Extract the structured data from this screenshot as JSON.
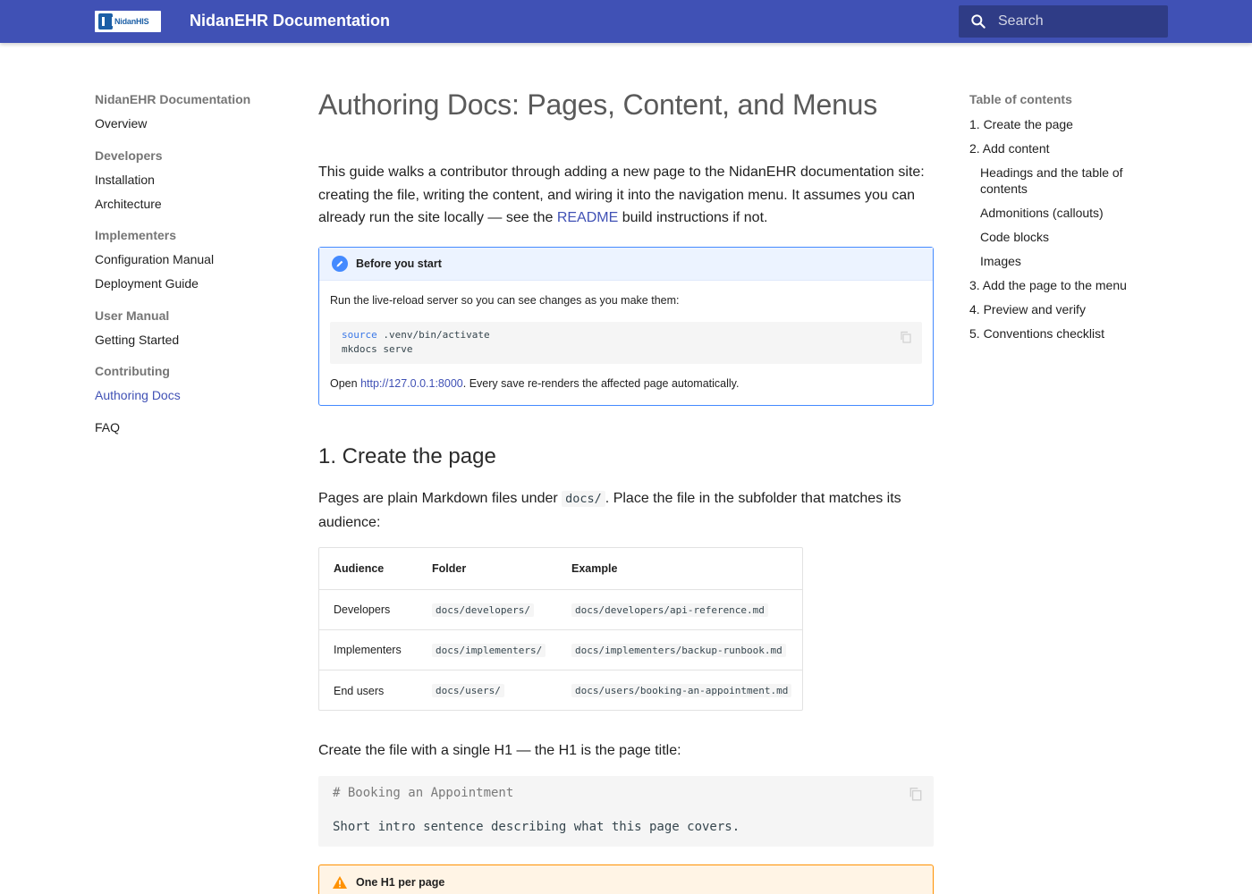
{
  "header": {
    "logo_text": "NidanHIS",
    "site_title": "NidanEHR Documentation",
    "search_placeholder": "Search"
  },
  "nav": {
    "root_title": "NidanEHR Documentation",
    "overview": "Overview",
    "sections": [
      {
        "title": "Developers",
        "items": [
          "Installation",
          "Architecture"
        ]
      },
      {
        "title": "Implementers",
        "items": [
          "Configuration Manual",
          "Deployment Guide"
        ]
      },
      {
        "title": "User Manual",
        "items": [
          "Getting Started"
        ]
      },
      {
        "title": "Contributing",
        "items": [
          "Authoring Docs"
        ]
      }
    ],
    "faq": "FAQ",
    "active_item": "Authoring Docs"
  },
  "toc": {
    "title": "Table of contents",
    "items": [
      "1. Create the page",
      "2. Add content",
      "Headings and the table of contents",
      "Admonitions (callouts)",
      "Code blocks",
      "Images",
      "3. Add the page to the menu",
      "4. Preview and verify",
      "5. Conventions checklist"
    ]
  },
  "page": {
    "title": "Authoring Docs: Pages, Content, and Menus",
    "intro_line1": "This guide walks a contributor through adding a new page to the NidanEHR documentation site:",
    "intro_line2": "creating the file, writing the content, and wiring it into the navigation menu. It assumes you can",
    "intro_line3_before": "already run the site locally — see the ",
    "intro_link": "README",
    "intro_line3_after": " build instructions if not.",
    "note": {
      "title": "Before you start",
      "text": "Run the live-reload server so you can see changes as you make them:",
      "code_kw": "source",
      "code_line1_rest": " .venv/bin/activate",
      "code_line2": "mkdocs serve",
      "open_before": "Open ",
      "open_link": "http://127.0.0.1:8000",
      "open_after": ". Every save re-renders the affected page automatically."
    },
    "section1": {
      "heading": "1. Create the page",
      "p_before": "Pages are plain Markdown files under ",
      "p_code": "docs/",
      "p_after_line1": ". Place the file in the subfolder that matches its",
      "p_line2": "audience:",
      "table": {
        "headers": [
          "Audience",
          "Folder",
          "Example"
        ],
        "rows": [
          [
            "Developers",
            "docs/developers/",
            "docs/developers/api-reference.md"
          ],
          [
            "Implementers",
            "docs/implementers/",
            "docs/implementers/backup-runbook.md"
          ],
          [
            "End users",
            "docs/users/",
            "docs/users/booking-an-appointment.md"
          ]
        ]
      },
      "h1_note": "Create the file with a single H1 — the H1 is the page title:",
      "code_line1": "# Booking an Appointment",
      "code_line2": "Short intro sentence describing what this page covers.",
      "warning_title": "One H1 per page"
    }
  },
  "colors": {
    "header_bg": "#4051b5",
    "accent_link": "#4051b5",
    "note_border": "#448aff",
    "warning_border": "#ff9100"
  }
}
